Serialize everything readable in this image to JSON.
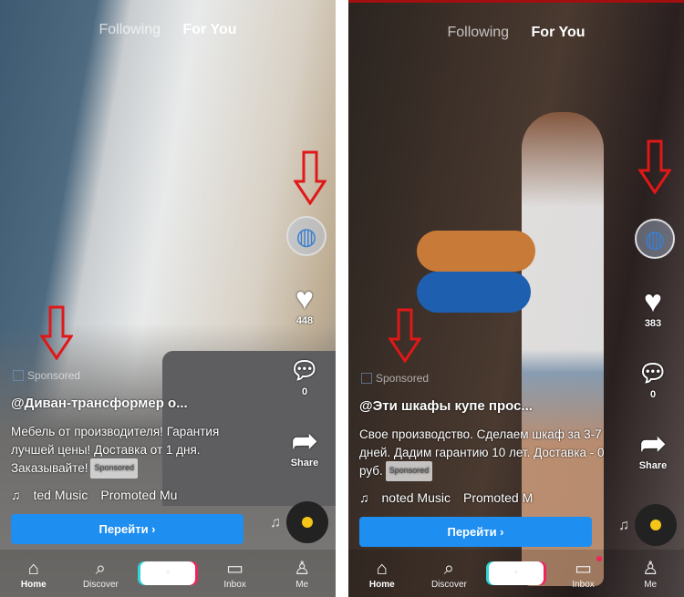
{
  "colors": {
    "accent": "#1e8ef0",
    "arrow": "#e01818",
    "disc_dot": "#f5c518"
  },
  "screens": [
    {
      "tabs": {
        "following": "Following",
        "for_you": "For You"
      },
      "likes": "448",
      "comments": "0",
      "share_label": "Share",
      "sponsored_label": "Sponsored",
      "handle": "@Диван-трансформер о...",
      "description": "Мебель от производителя! Гарантия лучшей цены! Доставка от 1 дня. Заказывайте!",
      "badge": "Sponsored",
      "music": [
        "ted Music",
        "Promoted Mu"
      ],
      "cta": "Перейти ›",
      "nav": {
        "home": "Home",
        "discover": "Discover",
        "inbox": "Inbox",
        "me": "Me"
      },
      "inbox_notification": false
    },
    {
      "tabs": {
        "following": "Following",
        "for_you": "For You"
      },
      "likes": "383",
      "comments": "0",
      "share_label": "Share",
      "sponsored_label": "Sponsored",
      "handle": "@Эти шкафы купе прос...",
      "description": "Свое производство. Сделаем шкаф за 3-7 дней. Дадим гарантию 10 лет. Доставка - 0 руб.",
      "badge": "Sponsored",
      "music": [
        "noted Music",
        "Promoted M"
      ],
      "cta": "Перейти ›",
      "nav": {
        "home": "Home",
        "discover": "Discover",
        "inbox": "Inbox",
        "me": "Me"
      },
      "inbox_notification": true
    }
  ]
}
